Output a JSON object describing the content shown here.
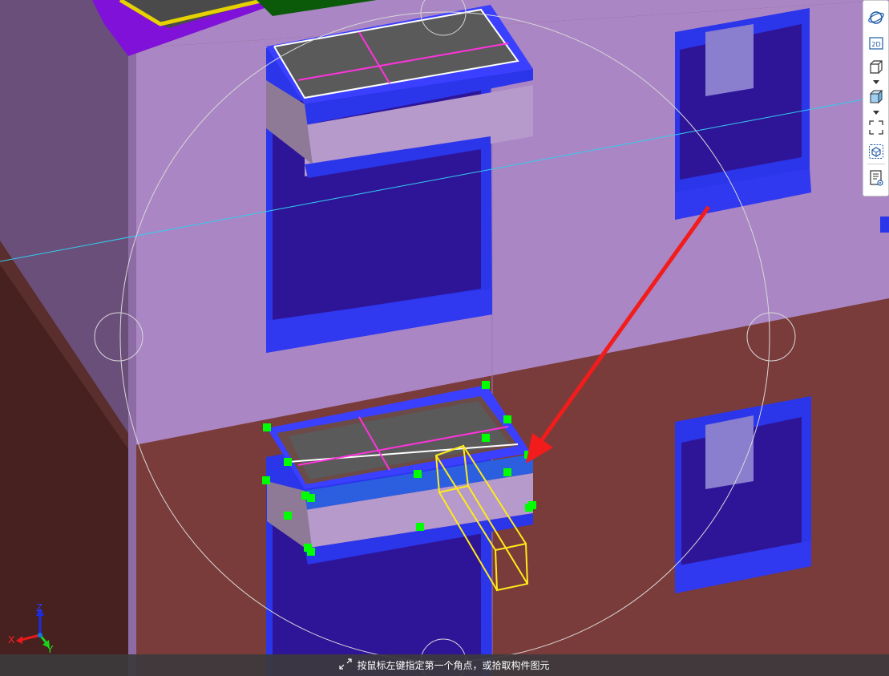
{
  "status": {
    "prompt": "按鼠标左键指定第一个角点，或拾取构件图元",
    "icon": "corner-select-icon"
  },
  "axis": {
    "x": "X",
    "y": "Y",
    "z": "Z"
  },
  "toolbar": {
    "items": [
      {
        "name": "orbit-view-icon"
      },
      {
        "name": "2d-view-icon",
        "label": "2D"
      },
      {
        "name": "box-view-icon"
      },
      {
        "name": "view-dropdown-icon"
      },
      {
        "name": "shaded-cube-icon"
      },
      {
        "name": "shade-dropdown-icon"
      },
      {
        "name": "fit-view-icon"
      },
      {
        "name": "section-box-icon"
      },
      {
        "name": "properties-view-icon"
      }
    ]
  },
  "colors": {
    "wall_upper": "#aa86c4",
    "wall_lower": "#7a3c3a",
    "glass": "#2e1598",
    "frame": "#2b35ea",
    "grip": "#00ff00",
    "selection": "#ffeb1a",
    "guide_line": "#33cdee",
    "pointer_arrow": "#f21c1c"
  }
}
